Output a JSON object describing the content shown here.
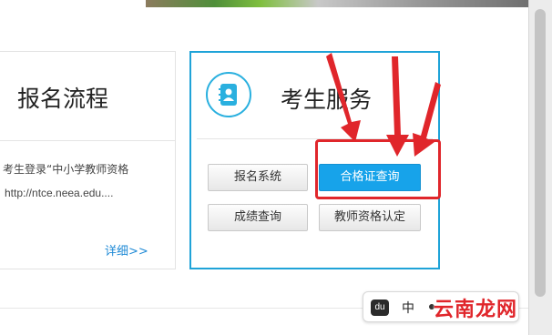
{
  "left_card": {
    "title": "报名流程",
    "line1": "考生登录“中小学教师资格",
    "line2": "http://ntce.neea.edu....",
    "more_link": "详细>>"
  },
  "right_card": {
    "title": "考生服务",
    "icon": "address-book-icon",
    "buttons": {
      "registration": "报名系统",
      "certificate_query": "合格证查询",
      "score_query": "成绩查询",
      "qualification": "教师资格认定"
    }
  },
  "ime": {
    "logo": "du",
    "mode": "中"
  },
  "watermark": "云南龙网",
  "colors": {
    "accent_blue": "#1fa3d8",
    "primary_button": "#17a3ea",
    "annotation_red": "#e0262b",
    "link_blue": "#1f8ad6"
  }
}
